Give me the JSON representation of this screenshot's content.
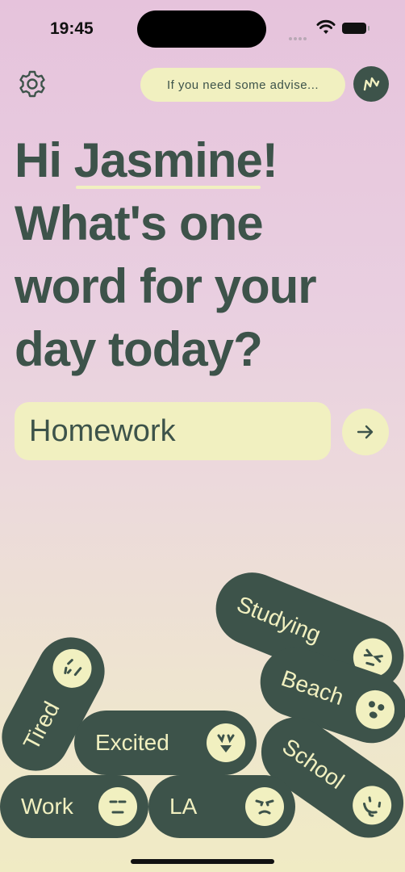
{
  "status_bar": {
    "time": "19:45"
  },
  "header": {
    "advice_text": "If you need some advise...",
    "settings_icon": "gear-icon",
    "logo_icon": "lightning-logo-icon"
  },
  "greeting": {
    "hi": "Hi",
    "name": "Jasmine",
    "exclaim": "!",
    "question_line1": "What's one",
    "question_line2": "word for your",
    "question_line3": "day today?"
  },
  "word_input": {
    "value": "Homework",
    "submit_icon": "arrow-right-icon"
  },
  "mood_chips": [
    {
      "label": "Studying",
      "face": "squinting-face-icon"
    },
    {
      "label": "Beach",
      "face": "surprised-face-icon"
    },
    {
      "label": "School",
      "face": "winking-tongue-face-icon"
    },
    {
      "label": "Tired",
      "face": "tired-face-icon"
    },
    {
      "label": "Excited",
      "face": "excited-face-icon"
    },
    {
      "label": "Work",
      "face": "neutral-face-icon"
    },
    {
      "label": "LA",
      "face": "annoyed-face-icon"
    }
  ],
  "colors": {
    "dark_green": "#3d534a",
    "cream": "#f1f0c0",
    "bg_top": "#e6c3dc",
    "bg_bottom": "#f0ebc4"
  }
}
